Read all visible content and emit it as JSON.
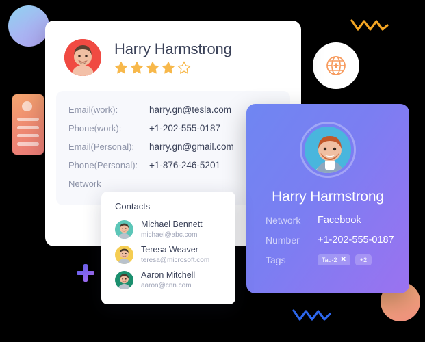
{
  "profile_card": {
    "name": "Harry Harmstrong",
    "avatar_icon": "user-avatar-photo",
    "rating": {
      "value": 4,
      "max": 5,
      "star_color": "#f7b84b"
    },
    "details": [
      {
        "label": "Email(work):",
        "value": "harry.gn@tesla.com"
      },
      {
        "label": "Phone(work):",
        "value": "+1-202-555-0187"
      },
      {
        "label": "Email(Personal):",
        "value": "harry.gn@gmail.com"
      },
      {
        "label": "Phone(Personal):",
        "value": "+1-876-246-5201"
      },
      {
        "label": "Network",
        "value": ""
      }
    ]
  },
  "social_card": {
    "name": "Harry Harmstrong",
    "avatar_icon": "user-avatar-photo",
    "rows": [
      {
        "label": "Network",
        "value": "Facebook"
      },
      {
        "label": "Number",
        "value": "+1-202-555-0187"
      }
    ],
    "tags_label": "Tags",
    "tags": [
      {
        "text": "Tag-2",
        "remove_icon": "close-icon"
      }
    ],
    "tags_overflow": "+2",
    "accent_start": "#6f86f2",
    "accent_end": "#9b72f0"
  },
  "contacts_popup": {
    "title": "Contacts",
    "items": [
      {
        "name": "Michael Bennett",
        "email": "michael@abc.com",
        "avatar_color": "#5cc6b8"
      },
      {
        "name": "Teresa Weaver",
        "email": "teresa@microsoft.com",
        "avatar_color": "#f5cd52"
      },
      {
        "name": "Aaron Mitchell",
        "email": "aaron@cnn.com",
        "avatar_color": "#1b8f6e"
      }
    ]
  },
  "decorations": {
    "circle_gradient_start": "#8fd3f0",
    "circle_gradient_end": "#b0a4f0",
    "orange_card_icon": "contact-card-placeholder",
    "plus_icon": "plus-icon",
    "badge_icon": "globe-plus-icon",
    "badge_icon_color": "#f79b5e",
    "zigzag_orange_color": "#f5a623",
    "zigzag_blue_color": "#2f6bf5",
    "orange_ball_color": "#f0907f"
  }
}
